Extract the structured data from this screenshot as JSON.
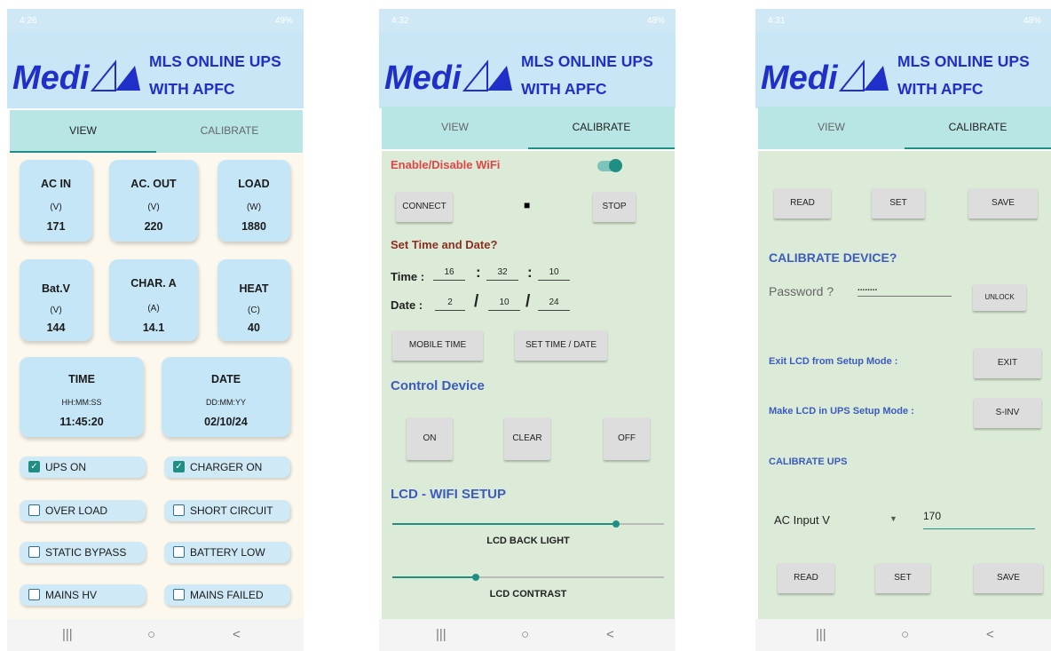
{
  "app": {
    "title_line1": "MLS ONLINE UPS",
    "title_line2": "WITH APFC",
    "logo_text": "Medi"
  },
  "tabs": {
    "view": "VIEW",
    "calibrate": "CALIBRATE"
  },
  "nav": {
    "recents": "|||",
    "home": "○",
    "back": "<"
  },
  "screen1": {
    "status_time": "4:26",
    "status_right": "49%",
    "cards": [
      {
        "label": "AC IN",
        "unit": "(V)",
        "value": "171"
      },
      {
        "label": "AC. OUT",
        "unit": "(V)",
        "value": "220"
      },
      {
        "label": "LOAD",
        "unit": "(W)",
        "value": "1880"
      },
      {
        "label": "Bat.V",
        "unit": "(V)",
        "value": "144"
      },
      {
        "label": "CHAR. A",
        "unit": "(A)",
        "value": "14.1"
      },
      {
        "label": "HEAT",
        "unit": "(C)",
        "value": "40"
      }
    ],
    "time_card": {
      "label": "TIME",
      "unit": "HH:MM:SS",
      "value": "11:45:20"
    },
    "date_card": {
      "label": "DATE",
      "unit": "DD:MM:YY",
      "value": "02/10/24"
    },
    "checks": [
      {
        "label": "UPS ON",
        "checked": true
      },
      {
        "label": "CHARGER ON",
        "checked": true
      },
      {
        "label": "OVER LOAD",
        "checked": false
      },
      {
        "label": "SHORT CIRCUIT",
        "checked": false
      },
      {
        "label": "STATIC BYPASS",
        "checked": false
      },
      {
        "label": "BATTERY LOW",
        "checked": false
      },
      {
        "label": "MAINS HV",
        "checked": false
      },
      {
        "label": "MAINS FAILED",
        "checked": false
      }
    ]
  },
  "screen2": {
    "status_time": "4:32",
    "status_right": "48%",
    "wifi_label": "Enable/Disable WiFi",
    "wifi_enabled": true,
    "connect": "CONNECT",
    "indicator": "■",
    "stop": "STOP",
    "set_time_title": "Set Time and Date?",
    "time_label": "Time :",
    "time_values": [
      "16",
      "32",
      "10"
    ],
    "time_sep": ":",
    "date_label": "Date :",
    "date_values": [
      "2",
      "10",
      "24"
    ],
    "date_sep": "/",
    "mobile_time": "MOBILE TIME",
    "set_time_date": "SET TIME / DATE",
    "control_title": "Control Device",
    "on": "ON",
    "clear": "CLEAR",
    "off": "OFF",
    "lcd_title": "LCD - WIFI SETUP",
    "backlight_label": "LCD BACK LIGHT",
    "backlight_level": 0.85,
    "contrast_label": "LCD CONTRAST",
    "contrast_level": 0.31
  },
  "screen3": {
    "status_time": "4:31",
    "status_right": "48%",
    "read": "READ",
    "set": "SET",
    "save": "SAVE",
    "calibrate_title": "CALIBRATE DEVICE?",
    "password_label": "Password ?",
    "password_value": "........",
    "unlock": "UNLOCK",
    "exit_label": "Exit LCD from  Setup Mode :",
    "exit": "EXIT",
    "sinv_label": "Make LCD in UPS Setup Mode :",
    "sinv": "S-INV",
    "calibrate_ups": "CALIBRATE UPS",
    "dropdown_value": "AC Input V",
    "input_value": "170"
  },
  "colors": {
    "header": "#c9e6f7",
    "tabs": "#b7e6e4",
    "accent": "#1f8f84",
    "title_blue": "#1f2fc8",
    "panel_green": "#dcebd7",
    "panel_cream": "#fcf8ed"
  }
}
